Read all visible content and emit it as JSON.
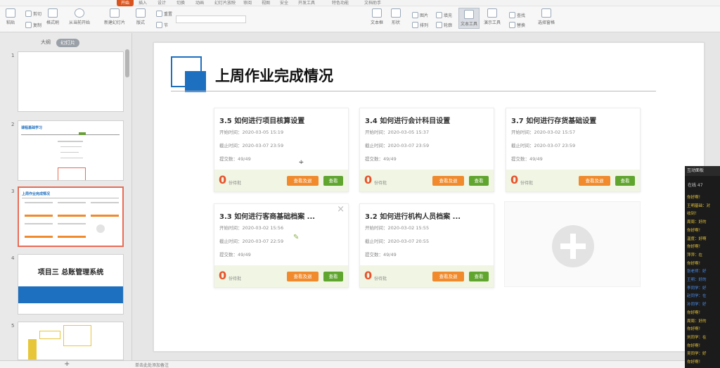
{
  "top_tabs": [
    "开始",
    "插入",
    "设计",
    "切换",
    "动画",
    "幻灯片放映",
    "审阅",
    "视图",
    "安全",
    "开发工具",
    "特色功能",
    "文档助手"
  ],
  "toolbar": {
    "paste": "粘贴",
    "cut": "剪切",
    "copy": "复制",
    "format_painter": "格式刷",
    "from_current": "从当前开始",
    "new_slide": "新建幻灯片",
    "layout": "版式",
    "section": "节",
    "reset": "重置",
    "textbox": "文本框",
    "shape": "形状",
    "arrange": "排列",
    "picture": "图片",
    "fill": "填充",
    "outline": "轮廓",
    "find": "查找",
    "replace": "替换",
    "select_pane": "选择窗格",
    "text_tool": "文本工具",
    "presentation_tool": "演示工具"
  },
  "left_panel": {
    "tabs": [
      "大纲",
      "幻灯片"
    ],
    "slides": [
      {
        "num": "1"
      },
      {
        "num": "2",
        "title": "课程基础学习"
      },
      {
        "num": "3",
        "title": "上周作业完成情况"
      },
      {
        "num": "4",
        "title": "项目三 总账管理系统"
      },
      {
        "num": "5"
      }
    ]
  },
  "slide": {
    "title": "上周作业完成情况",
    "cards": [
      {
        "title": "3.5 如何进行项目核算设置",
        "start": "开始时间：2020-03-05 15:19",
        "end": "截止时间：2020-03-07 23:59",
        "submitted": "提交数：49/49",
        "count": "0",
        "count_label": "份待批",
        "btn1": "查看及退",
        "btn2": "查看"
      },
      {
        "title": "3.4 如何进行会计科目设置",
        "start": "开始时间：2020-03-05 15:37",
        "end": "截止时间：2020-03-07 23:59",
        "submitted": "提交数：49/49",
        "count": "0",
        "count_label": "份待批",
        "btn1": "查看及退",
        "btn2": "查看"
      },
      {
        "title": "3.7 如何进行存货基础设置",
        "start": "开始时间：2020-03-02 15:57",
        "end": "截止时间：2020-03-07 23:59",
        "submitted": "提交数：49/49",
        "count": "0",
        "count_label": "份待批",
        "btn1": "查看及退",
        "btn2": "查看"
      },
      {
        "title": "3.3 如何进行客商基础档案 ...",
        "start": "开始时间：2020-03-02 15:56",
        "end": "截止时间：2020-03-07 22:59",
        "submitted": "提交数：49/49",
        "count": "0",
        "count_label": "份待批",
        "btn1": "查看及退",
        "btn2": "查看"
      },
      {
        "title": "3.2 如何进行机构人员档案 ...",
        "start": "开始时间：2020-03-02 15:55",
        "end": "截止时间：2020-03-07 20:55",
        "submitted": "提交数：49/49",
        "count": "0",
        "count_label": "份待批",
        "btn1": "查看及退",
        "btn2": "查看"
      }
    ]
  },
  "chat": {
    "header": "互动面板",
    "online": "在线 47",
    "messages": [
      {
        "text": "你好啊！",
        "color": "#e8c63a"
      },
      {
        "text": "王明基础：对",
        "color": "#e8c63a"
      },
      {
        "text": "收到！",
        "color": "#e8c63a"
      },
      {
        "text": "周周：好的",
        "color": "#e8c63a"
      },
      {
        "text": "你好啊！",
        "color": "#e8c63a"
      },
      {
        "text": "温度：好啊",
        "color": "#e8c63a"
      },
      {
        "text": "你好啊！",
        "color": "#e8c63a"
      },
      {
        "text": "萍萍：在",
        "color": "#e8c63a"
      },
      {
        "text": "你好啊！",
        "color": "#e8c63a"
      },
      {
        "text": "张老师：好",
        "color": "#4c8ff0"
      },
      {
        "text": "王明：好的",
        "color": "#4c8ff0"
      },
      {
        "text": "李同学：好",
        "color": "#4c8ff0"
      },
      {
        "text": "赵同学：在",
        "color": "#4c8ff0"
      },
      {
        "text": "孙同学：好",
        "color": "#4c8ff0"
      },
      {
        "text": "你好啊！",
        "color": "#e8c63a"
      },
      {
        "text": "周周：好的",
        "color": "#e8c63a"
      },
      {
        "text": "你好啊！",
        "color": "#e8c63a"
      },
      {
        "text": "刘同学：在",
        "color": "#e8c63a"
      },
      {
        "text": "你好啊！",
        "color": "#e8c63a"
      },
      {
        "text": "吴同学：好",
        "color": "#e8c63a"
      },
      {
        "text": "你好啊！",
        "color": "#e8c63a"
      }
    ]
  },
  "bottom": {
    "add_slide": "+",
    "note": "单击此处添加备注"
  }
}
